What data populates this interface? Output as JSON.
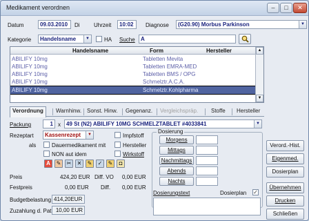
{
  "window": {
    "title": "Medikament verordnen",
    "controls": {
      "minimize": "–",
      "maximize": "□",
      "close": "✕"
    }
  },
  "header": {
    "datum_label": "Datum",
    "datum_value": "09.03.2010",
    "weekday": "Di",
    "uhrzeit_label": "Uhrzeit",
    "uhrzeit_value": "10:02",
    "diagnose_label": "Diagnose",
    "diagnose_value": "(G20.90) Morbus Parkinson"
  },
  "filter": {
    "kategorie_label": "Kategorie",
    "kategorie_value": "Handelsname",
    "ha_label": "HA",
    "suche_label": "Suche",
    "suche_value": "A"
  },
  "list": {
    "columns": [
      "Handelsname",
      "Form",
      "Hersteller"
    ],
    "rows": [
      {
        "name": "ABILIFY 10mg",
        "form": "Tabletten Mevita",
        "hersteller": ""
      },
      {
        "name": "ABILIFY 10mg",
        "form": "Tabletten EMRA-MED",
        "hersteller": ""
      },
      {
        "name": "ABILIFY 10mg",
        "form": "Tabletten BMS / OPG",
        "hersteller": ""
      },
      {
        "name": "ABILIFY 10mg",
        "form": "Schmelztr.A.C.A.",
        "hersteller": ""
      },
      {
        "name": "ABILIFY 10mg",
        "form": "Schmelztr.Kohlpharma",
        "hersteller": ""
      }
    ],
    "selected_index": 4
  },
  "tabs": [
    {
      "label": "Verordnung",
      "state": "active"
    },
    {
      "label": "Warnhinw.",
      "state": "normal"
    },
    {
      "label": "Sonst. Hinw.",
      "state": "normal"
    },
    {
      "label": "Gegenanz.",
      "state": "normal"
    },
    {
      "label": "Vergleichspräp.",
      "state": "disabled"
    },
    {
      "label": "Stoffe",
      "state": "normal"
    },
    {
      "label": "Hersteller",
      "state": "normal"
    }
  ],
  "verordnung": {
    "packung_label": "Packung",
    "packung_qty": "1",
    "packung_x": "x",
    "packung_value": "49 St (N2) ABILIFY 10MG SCHMELZTABLET #4033841",
    "rezeptart_label": "Rezeptart",
    "rezeptart_value": "Kassenrezept",
    "als_label": "als",
    "checkboxes": {
      "impfstoff": "Impfstoff",
      "dauermedikament": "Dauermedikament mit",
      "hersteller": "Hersteller",
      "non_aut_idem": "NON aut idem",
      "wirkstoff": "Wirkstoff"
    },
    "preis_label": "Preis",
    "preis_value": "424,20 EUR",
    "diff_vo_label": "Diff. VO",
    "diff_vo_value": "0,00 EUR",
    "festpreis_label": "Festpreis",
    "festpreis_value": "0,00 EUR",
    "diff_label": "Diff.",
    "diff_value": "0,00 EUR",
    "budget_label": "Budgetbelastung",
    "budget_value": "414,20EUR",
    "zuzahlung_label": "Zuzahlung d. Pat.",
    "zuzahlung_value": "10,00 EUR"
  },
  "dosierung": {
    "group_label": "Dosierung",
    "morgens": "Morgens",
    "mittags": "Mittags",
    "nachmittags": "Nachmittags",
    "abends": "Abends",
    "nachts": "Nachts",
    "text_label": "Dosierungstext",
    "plan_label": "Dosierplan"
  },
  "buttons": {
    "verord_hist": "Verord.-Hist.",
    "eigenmed": "Eigenmed.",
    "dosierplan": "Dosierplan",
    "uebernehmen": "Übernehmen",
    "drucken": "Drucken",
    "schliessen": "Schließen"
  },
  "colors": {
    "accent": "#1a237e",
    "selection": "#5064a0",
    "list_text": "#5c5fa8"
  }
}
